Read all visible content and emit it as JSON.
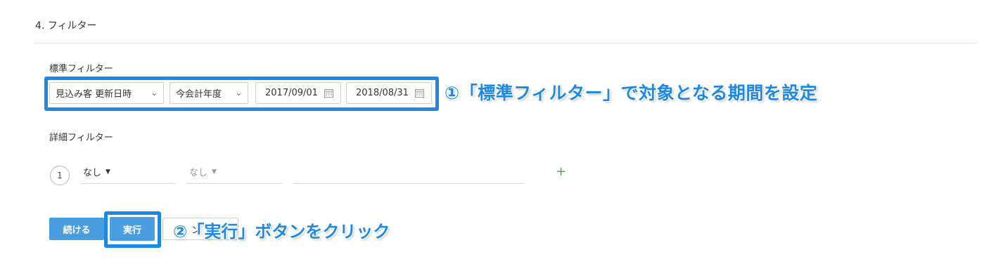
{
  "section": {
    "title": "4.  フィルター"
  },
  "standard_filter": {
    "label": "標準フィルター",
    "field": {
      "value": "見込み客 更新日時"
    },
    "period": {
      "value": "今会計年度"
    },
    "start_date": "2017/09/01",
    "end_date": "2018/08/31"
  },
  "detail_filter": {
    "label": "詳細フィルター",
    "row_number": "1",
    "condition1": "なし",
    "condition2": "なし",
    "add": "+"
  },
  "buttons": {
    "continue": "続ける",
    "run": "実行",
    "cancel_partial": "ン"
  },
  "annotations": {
    "callout1": "①「標準フィルター」で対象となる期間を設定",
    "callout2": "②「実行」ボタンをクリック",
    "accent_color": "#1e88e5"
  },
  "icons": {
    "chevron": "chevron-down-icon",
    "calendar": "calendar-icon",
    "caret": "caret-down-icon"
  }
}
